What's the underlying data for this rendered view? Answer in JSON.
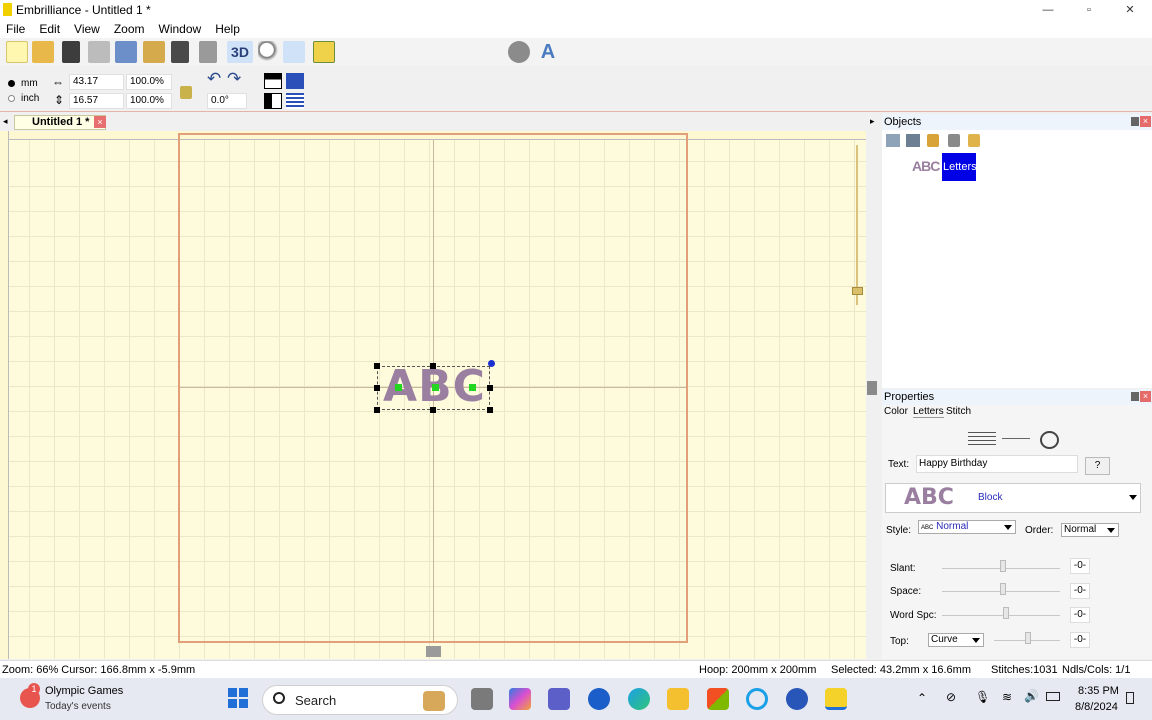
{
  "window": {
    "title": "Embrilliance -  Untitled 1 *",
    "minimize": "—",
    "maximize": "▫",
    "close": "✕"
  },
  "menu": [
    "File",
    "Edit",
    "View",
    "Zoom",
    "Window",
    "Help"
  ],
  "toolbar": {
    "three_d_label": "3D",
    "units": {
      "mm": "mm",
      "inch": "inch",
      "selected": "mm"
    },
    "width_value": "43.17",
    "height_value": "16.57",
    "width_percent": "100.0%",
    "height_percent": "100.0%",
    "rotation_value": "0.0°"
  },
  "tab": {
    "label": "Untitled 1 *",
    "close": "×"
  },
  "canvas": {
    "design_text": "ABC"
  },
  "objects_panel": {
    "title": "Objects",
    "item_icon_text": "ABC",
    "item_label": "Letters"
  },
  "properties_panel": {
    "title": "Properties",
    "tabs": [
      "Color",
      "Letters",
      "Stitch"
    ],
    "text_label": "Text:",
    "text_value": "Happy Birthday",
    "help_button": "?",
    "font_preview": "ABC",
    "font_name": "Block",
    "style_label": "Style:",
    "style_prefix": "ABC",
    "style_value": "Normal",
    "order_label": "Order:",
    "order_value": "Normal",
    "sliders": [
      {
        "label": "Slant:",
        "value": "-0-"
      },
      {
        "label": "Space:",
        "value": "-0-"
      },
      {
        "label": "Word Spc:",
        "value": "-0-"
      },
      {
        "label": "Top:",
        "value": "-0-",
        "dropdown": "Curve"
      }
    ]
  },
  "status": {
    "zoom_cursor": "Zoom: 66%  Cursor: 166.8mm x -5.9mm",
    "hoop": "Hoop: 200mm x 200mm",
    "selected": "Selected: 43.2mm x 16.6mm",
    "stitches": "Stitches:1031",
    "ndls": "Ndls/Cols: 1/1"
  },
  "taskbar": {
    "news_badge": "1",
    "news_title": "Olympic Games",
    "news_subtitle": "Today's events",
    "search_placeholder": "Search",
    "time": "8:35 PM",
    "date": "8/8/2024"
  },
  "colors": {
    "canvas_bg": "#fefbdc",
    "hoop_border": "#e2a07a",
    "letters_fill": "#9a7fa0",
    "selection_blue": "#0000e6"
  }
}
